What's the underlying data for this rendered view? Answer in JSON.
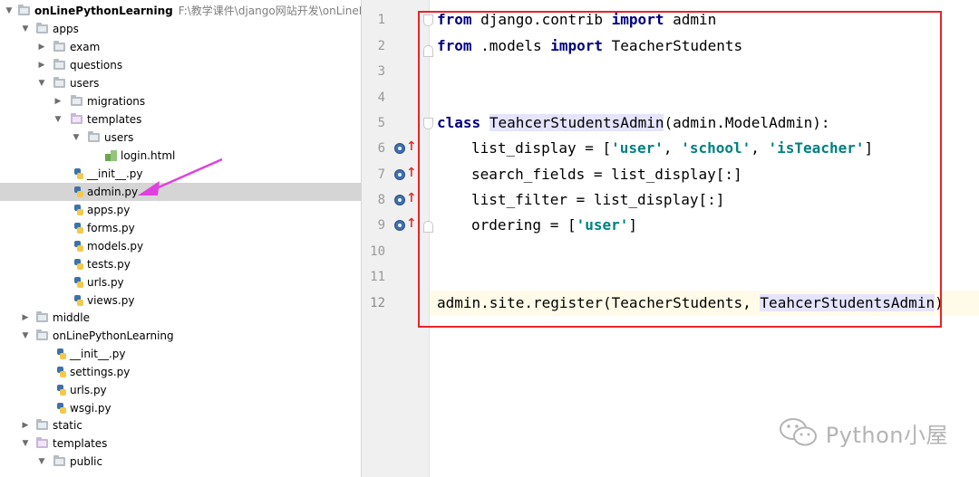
{
  "project_tree": {
    "root": {
      "label": "onLinePythonLearning",
      "path": "F:\\教学课件\\django网站开发\\onLinePython"
    },
    "items": [
      {
        "label": "apps"
      },
      {
        "label": "exam"
      },
      {
        "label": "questions"
      },
      {
        "label": "users"
      },
      {
        "label": "migrations"
      },
      {
        "label": "templates"
      },
      {
        "label": "users"
      },
      {
        "label": "login.html"
      },
      {
        "label": "__init__.py"
      },
      {
        "label": "admin.py"
      },
      {
        "label": "apps.py"
      },
      {
        "label": "forms.py"
      },
      {
        "label": "models.py"
      },
      {
        "label": "tests.py"
      },
      {
        "label": "urls.py"
      },
      {
        "label": "views.py"
      },
      {
        "label": "middle"
      },
      {
        "label": "onLinePythonLearning"
      },
      {
        "label": "__init__.py"
      },
      {
        "label": "settings.py"
      },
      {
        "label": "urls.py"
      },
      {
        "label": "wsgi.py"
      },
      {
        "label": "static"
      },
      {
        "label": "templates"
      },
      {
        "label": "public"
      }
    ],
    "selected": "admin.py"
  },
  "editor": {
    "line_numbers": [
      "1",
      "2",
      "3",
      "4",
      "5",
      "6",
      "7",
      "8",
      "9",
      "10",
      "11",
      "12"
    ],
    "current_line": "12",
    "code": {
      "l1": {
        "kw1": "from",
        "mod": " django.contrib ",
        "kw2": "import",
        "name": " admin"
      },
      "l2": {
        "kw1": "from",
        "mod": " .models ",
        "kw2": "import",
        "name": " TeacherStudents"
      },
      "l5": {
        "kw": "class",
        "sp": " ",
        "cls": "TeahcerStudentsAdmin",
        "rest": "(admin.ModelAdmin):"
      },
      "l6": {
        "a": "list_display = [",
        "s1": "'user'",
        "c1": ", ",
        "s2": "'school'",
        "c2": ", ",
        "s3": "'isTeacher'",
        "e": "]"
      },
      "l7": {
        "text": "search_fields = list_display[:]"
      },
      "l8": {
        "text": "list_filter = list_display[:]"
      },
      "l9": {
        "a": "ordering = [",
        "s1": "'user'",
        "e": "]"
      },
      "l12": {
        "a": "admin.site.register(TeacherStudents, ",
        "cls": "TeahcerStudentsAdmin",
        "e": ")"
      }
    }
  },
  "watermark": {
    "icon": "wechat-icon",
    "text": "Python小屋"
  },
  "colors": {
    "highlight_box": "#e8242a",
    "annotation_arrow": "#e040e0",
    "keyword": "#000080",
    "string": "#008080"
  }
}
